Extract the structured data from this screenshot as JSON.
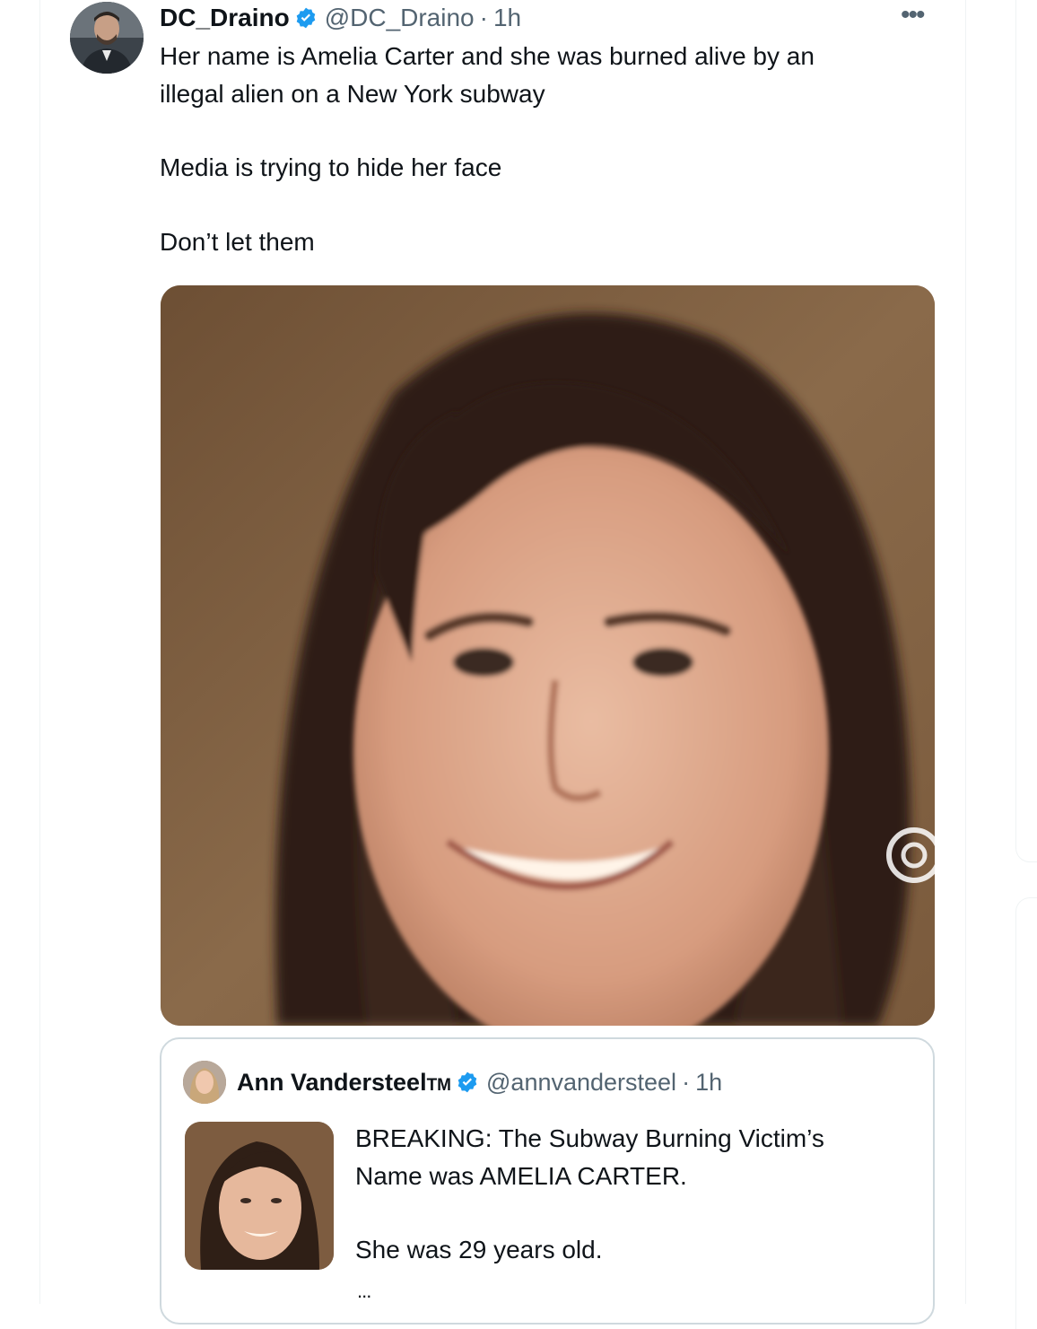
{
  "tweet": {
    "author": {
      "display_name": "DC_Draino",
      "handle": "@DC_Draino",
      "time": "1h",
      "separator": "·",
      "verified": true
    },
    "more_icon": "more-horizontal-icon",
    "text_lines": [
      "Her name is Amelia Carter and she was burned alive by an",
      "illegal alien on a New York subway",
      "Media is trying to hide her face",
      "Don’t let them"
    ],
    "media": {
      "type": "photo",
      "watermark_icon": "watermark-logo"
    }
  },
  "quoted_tweet": {
    "author": {
      "display_name": "Ann Vandersteel",
      "display_name_suffix": "TM",
      "handle": "@annvandersteel",
      "time": "1h",
      "separator": "·",
      "verified": true
    },
    "text_lines": [
      "BREAKING: The Subway Burning Victim’s",
      "Name was AMELIA CARTER.",
      "She was 29 years old."
    ],
    "ellipsis": "...",
    "media": {
      "type": "photo-thumbnail"
    }
  },
  "colors": {
    "text_primary": "#0f1419",
    "text_secondary": "#536471",
    "verified_blue": "#1d9bf0",
    "border": "#cfd9de"
  }
}
